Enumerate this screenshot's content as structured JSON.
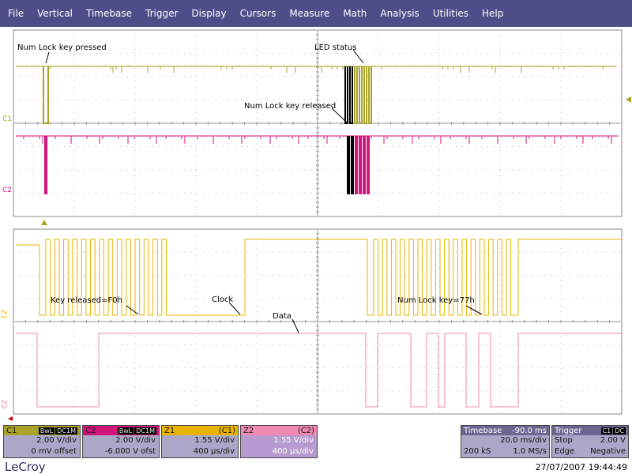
{
  "menu": [
    "File",
    "Vertical",
    "Timebase",
    "Trigger",
    "Display",
    "Cursors",
    "Measure",
    "Math",
    "Analysis",
    "Utilities",
    "Help"
  ],
  "colors": {
    "menubar": "#4e4d8a",
    "c1": "#a9a427",
    "c2": "#d1167a",
    "z1": "#e8b400",
    "z2": "#f08ab0",
    "grid": "#bbbbbb"
  },
  "annotations": {
    "num_lock_pressed": "Num Lock key pressed",
    "led_status": "LED status",
    "num_lock_released": "Num Lock key released",
    "key_released": "Key released=F0h",
    "clock": "Clock",
    "data": "Data",
    "num_lock_key": "Num Lock key=77h"
  },
  "trace_labels": {
    "c1": "C1",
    "c2": "C2",
    "z1": "Z1",
    "z2": "Z2"
  },
  "channels": {
    "c1": {
      "id": "C1",
      "badge1": "BwL",
      "badge2": "DC1M",
      "line1": "2.00 V/div",
      "line2": "0 mV offset"
    },
    "c2": {
      "id": "C2",
      "badge1": "BwL",
      "badge2": "DC1M",
      "line1": "2.00 V/div",
      "line2": "-6.000 V ofst"
    },
    "z1": {
      "id": "Z1",
      "src": "(C1)",
      "line1": "1.55 V/div",
      "line2": "400 µs/div"
    },
    "z2": {
      "id": "Z2",
      "src": "(C2)",
      "line1": "1.55 V/div",
      "line2": "400 µs/div"
    }
  },
  "timebase": {
    "title": "Timebase",
    "delay": "-90.0 ms",
    "per_div": "20.0 ms/div",
    "samples": "200 kS",
    "rate": "1.0 MS/s"
  },
  "trigger": {
    "title": "Trigger",
    "badge1": "C1",
    "badge2": "DC",
    "mode": "Stop",
    "level": "2.00 V",
    "type": "Edge",
    "slope": "Negative"
  },
  "footer": {
    "logo": "LeCroy",
    "datetime": "27/07/2007 19:44:49"
  }
}
